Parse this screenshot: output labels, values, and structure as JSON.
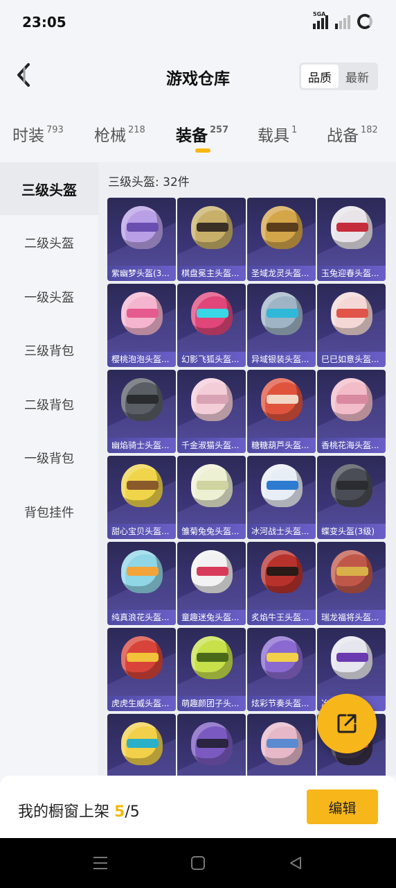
{
  "status_bar": {
    "time": "23:05",
    "network": "5GA"
  },
  "header": {
    "title": "游戏仓库",
    "sort_options": [
      "品质",
      "最新"
    ],
    "active_sort": "品质"
  },
  "category_tabs": [
    {
      "label": "时装",
      "count": "793"
    },
    {
      "label": "枪械",
      "count": "218"
    },
    {
      "label": "装备",
      "count": "257"
    },
    {
      "label": "载具",
      "count": "1"
    },
    {
      "label": "战备",
      "count": "182"
    }
  ],
  "sidebar": {
    "items": [
      "三级头盔",
      "二级头盔",
      "一级头盔",
      "三级背包",
      "二级背包",
      "一级背包",
      "背包挂件"
    ],
    "active": "三级头盔"
  },
  "content": {
    "section_title": "三级头盔: 32件",
    "items": [
      {
        "name": "紫幽梦头盔(3...",
        "color": "#b9a0e6",
        "visor": "#6b4fb0"
      },
      {
        "name": "棋盘冕主头盔...",
        "color": "#c8b06a",
        "visor": "#3a3026"
      },
      {
        "name": "圣域龙灵头盔...",
        "color": "#d3a64a",
        "visor": "#5a3e1c"
      },
      {
        "name": "玉兔迎春头盔...",
        "color": "#e9e4ea",
        "visor": "#c62d3c"
      },
      {
        "name": "樱桃泡泡头盔...",
        "color": "#f5b5cf",
        "visor": "#e65b8f"
      },
      {
        "name": "幻影飞狐头盔...",
        "color": "#e0467a",
        "visor": "#38d6e6"
      },
      {
        "name": "异域银装头盔...",
        "color": "#9fb5c6",
        "visor": "#2fb8d8"
      },
      {
        "name": "巳巳如意头盔...",
        "color": "#f3d8d6",
        "visor": "#e0544a"
      },
      {
        "name": "幽焰骑士头盔...",
        "color": "#5a5f66",
        "visor": "#2a2c30"
      },
      {
        "name": "千金淑猫头盔...",
        "color": "#f3cdd8",
        "visor": "#d9a3b5"
      },
      {
        "name": "糖糖葫芦头盔...",
        "color": "#e0543e",
        "visor": "#f2d7c6"
      },
      {
        "name": "香桃花海头盔...",
        "color": "#f2bcc8",
        "visor": "#d98aa0"
      },
      {
        "name": "甜心宝贝头盔...",
        "color": "#f0d54a",
        "visor": "#8a5a2a"
      },
      {
        "name": "雏菊兔兔头盔...",
        "color": "#eef0d4",
        "visor": "#cfd4a0"
      },
      {
        "name": "冰河战士头盔...",
        "color": "#e8eef6",
        "visor": "#2d7bd0"
      },
      {
        "name": "蝶变头盔(3级)",
        "color": "#4a4d55",
        "visor": "#2a2c30"
      },
      {
        "name": "纯真浪花头盔...",
        "color": "#8fd6e6",
        "visor": "#f2a43a"
      },
      {
        "name": "童趣迷兔头盔...",
        "color": "#f2f2f2",
        "visor": "#d83a5a"
      },
      {
        "name": "炙焰牛王头盔...",
        "color": "#b8322c",
        "visor": "#2a1a18"
      },
      {
        "name": "瑞龙福将头盔...",
        "color": "#c0584a",
        "visor": "#d8b04a"
      },
      {
        "name": "虎虎生威头盔...",
        "color": "#d8443a",
        "visor": "#f2c23a"
      },
      {
        "name": "萌趣颜团子头...",
        "color": "#c8e04a",
        "visor": "#4a6a1a"
      },
      {
        "name": "炫彩节奏头盔...",
        "color": "#8a6ad0",
        "visor": "#f2d04a"
      },
      {
        "name": "冶...",
        "color": "#e6e6ee",
        "visor": "#6a3ab0"
      },
      {
        "name": "",
        "color": "#f2d04a",
        "visor": "#2ab0c8"
      },
      {
        "name": "",
        "color": "#7a5ac0",
        "visor": "#2a2440"
      },
      {
        "name": "",
        "color": "#e6b8c8",
        "visor": "#5a8ad0"
      },
      {
        "name": "",
        "color": "#3a3046",
        "visor": "#d04a7a"
      }
    ]
  },
  "bottom_bar": {
    "showcase_label": "我的橱窗上架",
    "showcase_count": "5",
    "showcase_total": "/5",
    "edit_label": "编辑"
  },
  "icons": {
    "back": "back-arrow-icon",
    "share": "share-external-icon",
    "accent_color": "#f7b61a"
  }
}
